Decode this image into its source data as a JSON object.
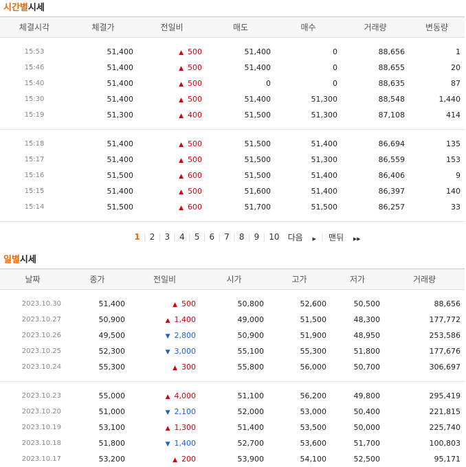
{
  "time_section": {
    "title_highlight": "시간별",
    "title_rest": "시세",
    "columns": [
      "체결시각",
      "체결가",
      "전일비",
      "매도",
      "매수",
      "거래량",
      "변동량"
    ],
    "groups": [
      [
        {
          "time": "15:53",
          "price": "51,400",
          "dir": "up",
          "change": "500",
          "sell": "51,400",
          "buy": "0",
          "volume": "88,656",
          "delta": "1"
        },
        {
          "time": "15:46",
          "price": "51,400",
          "dir": "up",
          "change": "500",
          "sell": "51,400",
          "buy": "0",
          "volume": "88,655",
          "delta": "20"
        },
        {
          "time": "15:40",
          "price": "51,400",
          "dir": "up",
          "change": "500",
          "sell": "0",
          "buy": "0",
          "volume": "88,635",
          "delta": "87"
        },
        {
          "time": "15:30",
          "price": "51,400",
          "dir": "up",
          "change": "500",
          "sell": "51,400",
          "buy": "51,300",
          "volume": "88,548",
          "delta": "1,440"
        },
        {
          "time": "15:19",
          "price": "51,300",
          "dir": "up",
          "change": "400",
          "sell": "51,500",
          "buy": "51,300",
          "volume": "87,108",
          "delta": "414"
        }
      ],
      [
        {
          "time": "15:18",
          "price": "51,400",
          "dir": "up",
          "change": "500",
          "sell": "51,500",
          "buy": "51,400",
          "volume": "86,694",
          "delta": "135"
        },
        {
          "time": "15:17",
          "price": "51,400",
          "dir": "up",
          "change": "500",
          "sell": "51,500",
          "buy": "51,300",
          "volume": "86,559",
          "delta": "153"
        },
        {
          "time": "15:16",
          "price": "51,500",
          "dir": "up",
          "change": "600",
          "sell": "51,500",
          "buy": "51,400",
          "volume": "86,406",
          "delta": "9"
        },
        {
          "time": "15:15",
          "price": "51,400",
          "dir": "up",
          "change": "500",
          "sell": "51,600",
          "buy": "51,400",
          "volume": "86,397",
          "delta": "140"
        },
        {
          "time": "15:14",
          "price": "51,500",
          "dir": "up",
          "change": "600",
          "sell": "51,700",
          "buy": "51,500",
          "volume": "86,257",
          "delta": "33"
        }
      ]
    ]
  },
  "pagination": {
    "pages": [
      "1",
      "2",
      "3",
      "4",
      "5",
      "6",
      "7",
      "8",
      "9",
      "10"
    ],
    "current": "1",
    "next_label": "다음",
    "last_label": "맨뒤"
  },
  "daily_section": {
    "title_highlight": "일별",
    "title_rest": "시세",
    "columns": [
      "날짜",
      "종가",
      "전일비",
      "시가",
      "고가",
      "저가",
      "거래량"
    ],
    "groups": [
      [
        {
          "date": "2023.10.30",
          "close": "51,400",
          "dir": "up",
          "change": "500",
          "open": "50,800",
          "high": "52,600",
          "low": "50,500",
          "volume": "88,656"
        },
        {
          "date": "2023.10.27",
          "close": "50,900",
          "dir": "up",
          "change": "1,400",
          "open": "49,000",
          "high": "51,500",
          "low": "48,300",
          "volume": "177,772"
        },
        {
          "date": "2023.10.26",
          "close": "49,500",
          "dir": "down",
          "change": "2,800",
          "open": "50,900",
          "high": "51,900",
          "low": "48,950",
          "volume": "253,586"
        },
        {
          "date": "2023.10.25",
          "close": "52,300",
          "dir": "down",
          "change": "3,000",
          "open": "55,100",
          "high": "55,300",
          "low": "51,800",
          "volume": "177,676"
        },
        {
          "date": "2023.10.24",
          "close": "55,300",
          "dir": "up",
          "change": "300",
          "open": "55,800",
          "high": "56,000",
          "low": "50,700",
          "volume": "306,697"
        }
      ],
      [
        {
          "date": "2023.10.23",
          "close": "55,000",
          "dir": "up",
          "change": "4,000",
          "open": "51,100",
          "high": "56,200",
          "low": "49,800",
          "volume": "295,419"
        },
        {
          "date": "2023.10.20",
          "close": "51,000",
          "dir": "down",
          "change": "2,100",
          "open": "52,000",
          "high": "53,000",
          "low": "50,400",
          "volume": "221,815"
        },
        {
          "date": "2023.10.19",
          "close": "53,100",
          "dir": "up",
          "change": "1,300",
          "open": "51,400",
          "high": "53,500",
          "low": "50,000",
          "volume": "225,740"
        },
        {
          "date": "2023.10.18",
          "close": "51,800",
          "dir": "down",
          "change": "1,400",
          "open": "52,700",
          "high": "53,600",
          "low": "51,700",
          "volume": "100,803"
        },
        {
          "date": "2023.10.17",
          "close": "53,200",
          "dir": "up",
          "change": "200",
          "open": "53,900",
          "high": "54,100",
          "low": "52,500",
          "volume": "95,171"
        }
      ]
    ]
  },
  "colors": {
    "up": "#d3000e",
    "down": "#1a5fe0",
    "accent": "#e86a10"
  },
  "icons": {
    "up": "triangle-up-icon",
    "down": "triangle-down-icon",
    "next": "caret-right-icon",
    "last": "double-chevron-right-icon"
  }
}
